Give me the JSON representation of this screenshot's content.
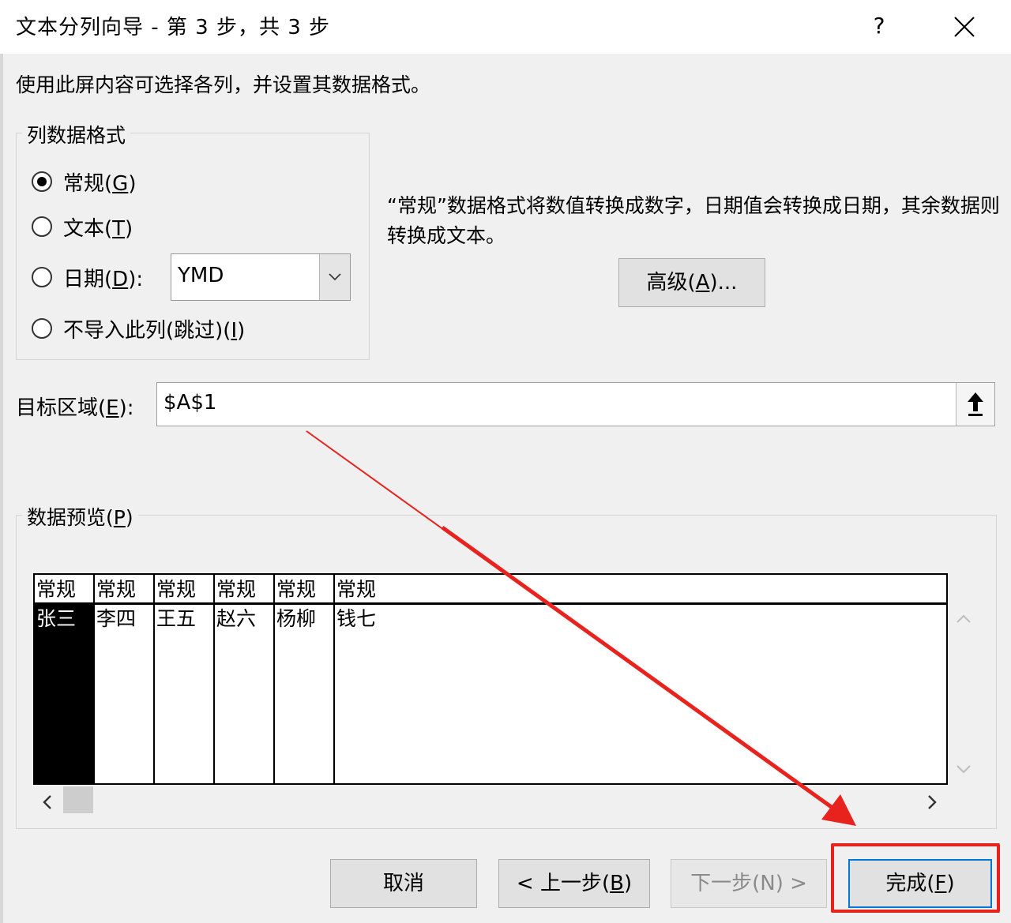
{
  "dialog": {
    "title": "文本分列向导 - 第 3 步，共 3 步",
    "help_label": "?",
    "instruction": "使用此屏内容可选择各列，并设置其数据格式。"
  },
  "column_format": {
    "legend": "列数据格式",
    "options": [
      {
        "pre": "常规(",
        "key": "G",
        "post": ")",
        "checked": true
      },
      {
        "pre": "文本(",
        "key": "T",
        "post": ")",
        "checked": false
      },
      {
        "pre": "日期(",
        "key": "D",
        "post": "):",
        "checked": false
      },
      {
        "pre": "不导入此列(跳过)(",
        "key": "I",
        "post": ")",
        "checked": false
      }
    ],
    "date_format": "YMD",
    "description": "“常规”数据格式将数值转换成数字，日期值会转换成日期，其余数据则转换成文本。",
    "advanced": {
      "pre": "高级(",
      "key": "A",
      "post": ")..."
    }
  },
  "destination": {
    "label_pre": "目标区域(",
    "label_key": "E",
    "label_post": "):",
    "value": "$A$1"
  },
  "preview": {
    "legend_pre": "数据预览(",
    "legend_key": "P",
    "legend_post": ")",
    "headers": [
      "常规",
      "常规",
      "常规",
      "常规",
      "常规",
      "常规"
    ],
    "row": [
      "张三",
      "李四",
      "王五",
      "赵六",
      "杨柳",
      "钱七"
    ],
    "selected_column": 0
  },
  "buttons": {
    "cancel": "取消",
    "back_pre": "< 上一步(",
    "back_key": "B",
    "back_post": ")",
    "next_pre": "下一步(",
    "next_key": "N",
    "next_post": ") >",
    "finish_pre": "完成(",
    "finish_key": "F",
    "finish_post": ")"
  },
  "colors": {
    "annotation": "#e8221d",
    "window_bg": "#f0f0f0"
  }
}
